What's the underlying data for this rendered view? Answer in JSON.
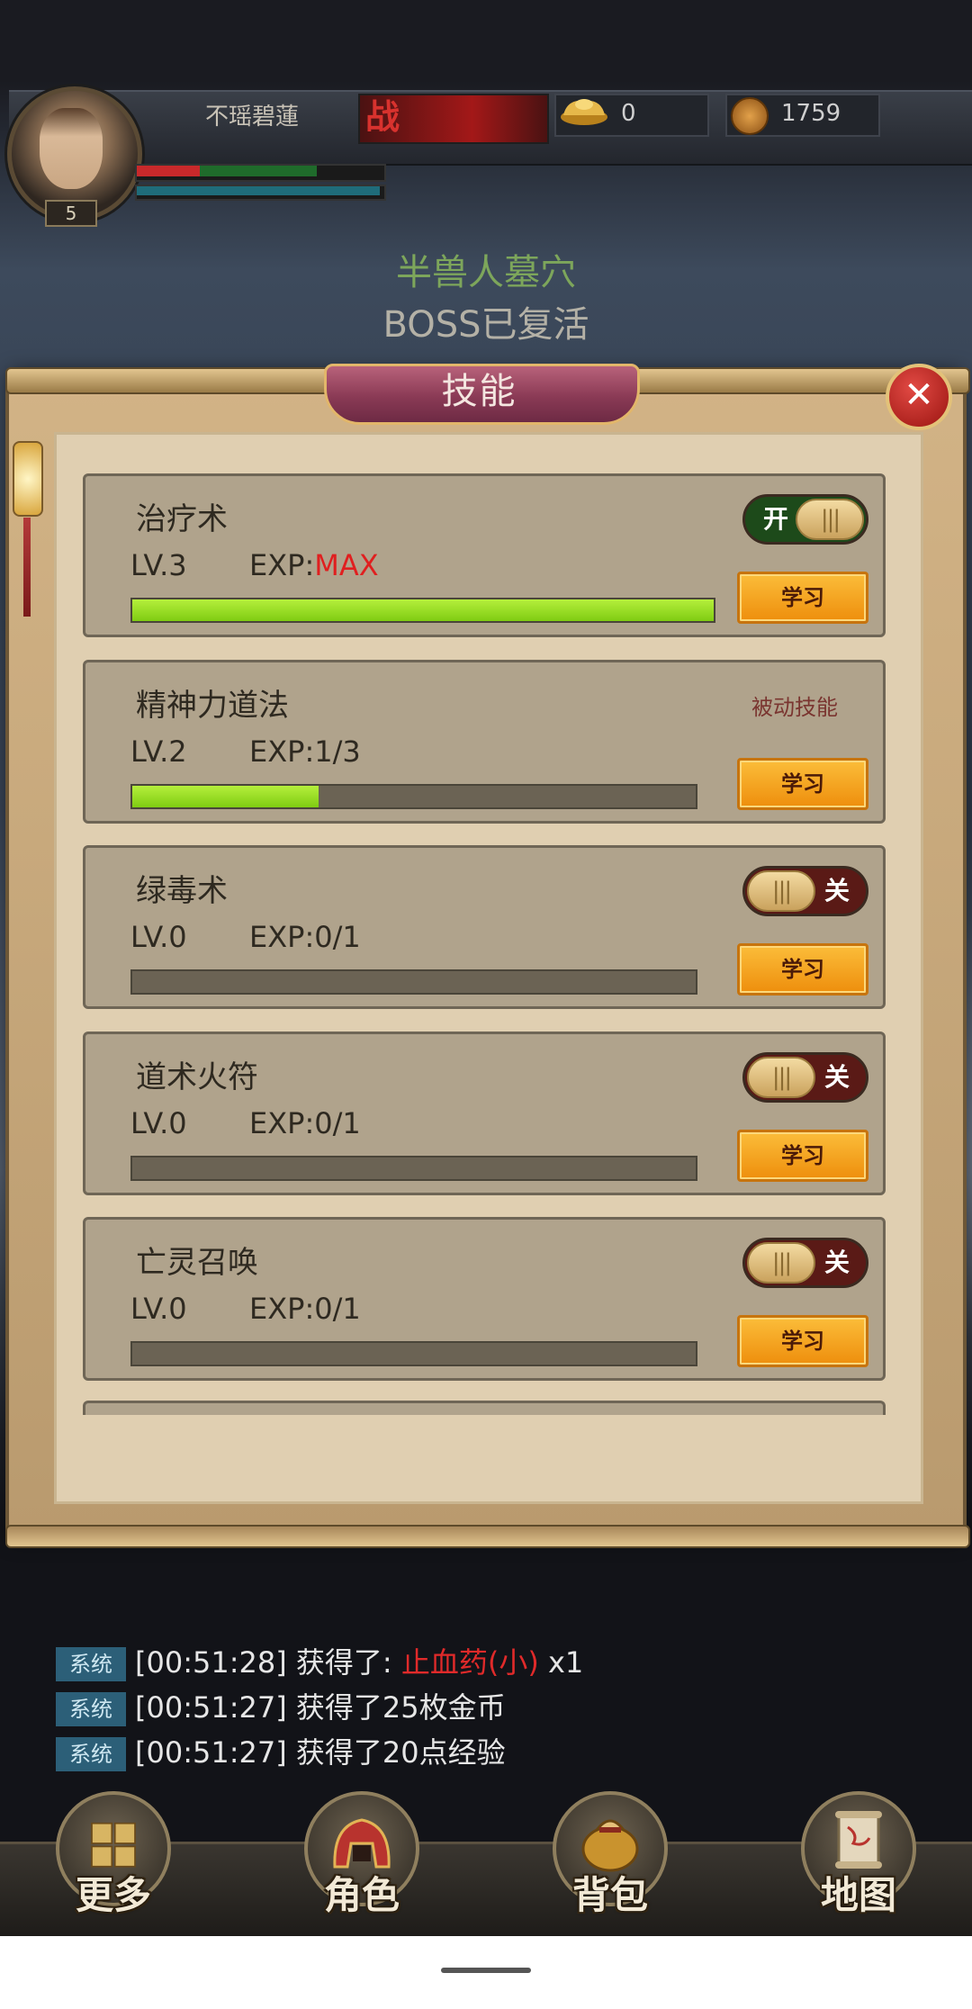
{
  "hud": {
    "player_name": "不瑶碧蓮",
    "level": "5",
    "battle_icon": "战",
    "ingot_value": "0",
    "coin_value": "1759"
  },
  "map": {
    "name": "半兽人墓穴",
    "boss_status": "BOSS已复活"
  },
  "panel": {
    "title": "技能",
    "close_icon": "✕"
  },
  "skills": [
    {
      "name": "治疗术",
      "level": "LV.3",
      "exp_prefix": "EXP:",
      "exp_value": "MAX",
      "progress": 1.0,
      "control": "toggle",
      "toggle_state": "on",
      "toggle_text": "开",
      "learn_label": "学习"
    },
    {
      "name": "精神力道法",
      "level": "LV.2",
      "exp_prefix": "EXP:",
      "exp_value": "1/3",
      "progress": 0.33,
      "control": "passive",
      "passive_label": "被动技能",
      "learn_label": "学习"
    },
    {
      "name": "绿毒术",
      "level": "LV.0",
      "exp_prefix": "EXP:",
      "exp_value": "0/1",
      "progress": 0,
      "control": "toggle",
      "toggle_state": "off",
      "toggle_text": "关",
      "learn_label": "学习"
    },
    {
      "name": "道术火符",
      "level": "LV.0",
      "exp_prefix": "EXP:",
      "exp_value": "0/1",
      "progress": 0,
      "control": "toggle",
      "toggle_state": "off",
      "toggle_text": "关",
      "learn_label": "学习"
    },
    {
      "name": "亡灵召唤",
      "level": "LV.0",
      "exp_prefix": "EXP:",
      "exp_value": "0/1",
      "progress": 0,
      "control": "toggle",
      "toggle_state": "off",
      "toggle_text": "关",
      "learn_label": "学习"
    }
  ],
  "toggle_knob_glyph": "|||",
  "chat": [
    {
      "tag": "系统",
      "time": "[00:51:28]",
      "text": "获得了:",
      "item": "止血药(小)",
      "suffix": "x1"
    },
    {
      "tag": "系统",
      "time": "[00:51:27]",
      "text": "获得了25枚金币",
      "item": "",
      "suffix": ""
    },
    {
      "tag": "系统",
      "time": "[00:51:27]",
      "text": "获得了20点经验",
      "item": "",
      "suffix": ""
    }
  ],
  "nav": [
    {
      "label": "更多",
      "icon": "grid-icon"
    },
    {
      "label": "角色",
      "icon": "helmet-icon"
    },
    {
      "label": "背包",
      "icon": "bag-icon"
    },
    {
      "label": "地图",
      "icon": "map-scroll-icon"
    }
  ],
  "colors": {
    "exp_max": "#e01f1f",
    "progress_fill": "#7fcc12",
    "map_name": "#7da65b",
    "chat_tag": "#2c5f78",
    "learn_button": "#ee8e0c"
  }
}
